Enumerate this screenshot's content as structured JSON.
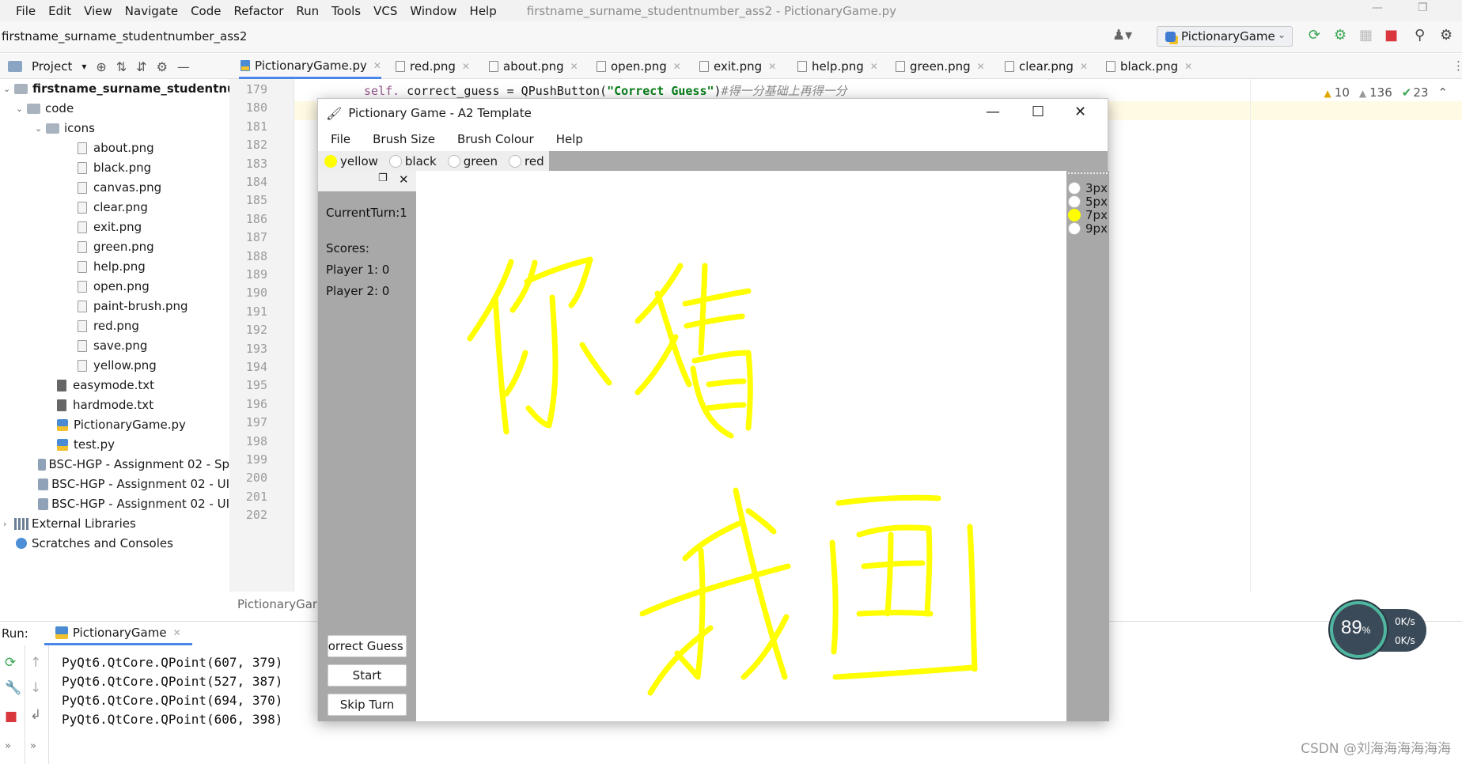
{
  "ide": {
    "menu": [
      "File",
      "Edit",
      "View",
      "Navigate",
      "Code",
      "Refactor",
      "Run",
      "Tools",
      "VCS",
      "Window",
      "Help"
    ],
    "window_title": "firstname_surname_studentnumber_ass2 - PictionaryGame.py",
    "breadcrumb": "firstname_surname_studentnumber_ass2",
    "run_config": "PictionaryGame",
    "project_label": "Project",
    "tabs": [
      "PictionaryGame.py",
      "red.png",
      "about.png",
      "open.png",
      "exit.png",
      "help.png",
      "green.png",
      "clear.png",
      "black.png"
    ],
    "inspections": {
      "warnings": "10",
      "weak_warnings": "136",
      "ok": "23"
    },
    "editor_breadcrumb": "PictionaryGam"
  },
  "tree": {
    "root": "firstname_surname_studentnum",
    "code": "code",
    "icons": "icons",
    "icon_files": [
      "about.png",
      "black.png",
      "canvas.png",
      "clear.png",
      "exit.png",
      "green.png",
      "help.png",
      "open.png",
      "paint-brush.png",
      "red.png",
      "save.png",
      "yellow.png"
    ],
    "code_files": [
      "easymode.txt",
      "hardmode.txt",
      "PictionaryGame.py",
      "test.py"
    ],
    "other_projects": [
      "BSC-HGP - Assignment 02 - Sp",
      "BSC-HGP - Assignment 02 - UI",
      "BSC-HGP - Assignment 02 - UI"
    ],
    "external": "External Libraries",
    "scratches": "Scratches and Consoles"
  },
  "editor": {
    "line_numbers": [
      "179",
      "180",
      "181",
      "182",
      "183",
      "184",
      "185",
      "186",
      "187",
      "188",
      "189",
      "190",
      "191",
      "192",
      "193",
      "194",
      "195",
      "196",
      "197",
      "198",
      "199",
      "200",
      "201",
      "202"
    ],
    "code_self": "self.",
    "code_mid": " correct_guess = QPushButton(",
    "code_str": "\"Correct Guess\"",
    "code_close": ")",
    "code_comment": "#得一分基础上再得一分"
  },
  "run": {
    "label": "Run:",
    "tab": "PictionaryGame",
    "console": [
      "PyQt6.QtCore.QPoint(607, 379)",
      "PyQt6.QtCore.QPoint(527, 387)",
      "PyQt6.QtCore.QPoint(694, 370)",
      "PyQt6.QtCore.QPoint(606, 398)"
    ]
  },
  "gauge": {
    "percent": "89",
    "unit": "%",
    "up": "0K/s",
    "down": "0K/s"
  },
  "watermark": "CSDN @刘海海海海海海",
  "pictionary": {
    "title": "Pictionary Game - A2 Template",
    "menu": [
      "File",
      "Brush Size",
      "Brush Colour",
      "Help"
    ],
    "colours": [
      {
        "label": "yellow",
        "selected": true
      },
      {
        "label": "black",
        "selected": false
      },
      {
        "label": "green",
        "selected": false
      },
      {
        "label": "red",
        "selected": false
      }
    ],
    "current_turn": "CurrentTurn:1",
    "scores_label": "Scores:",
    "player1": "Player 1: 0",
    "player2": "Player 2: 0",
    "buttons": {
      "correct": "Correct Guess",
      "start": "Start",
      "skip": "Skip Turn"
    },
    "sizes": [
      {
        "label": "3px",
        "selected": false
      },
      {
        "label": "5px",
        "selected": false
      },
      {
        "label": "7px",
        "selected": true
      },
      {
        "label": "9px",
        "selected": false
      }
    ],
    "brush_color": "#ffff00"
  }
}
